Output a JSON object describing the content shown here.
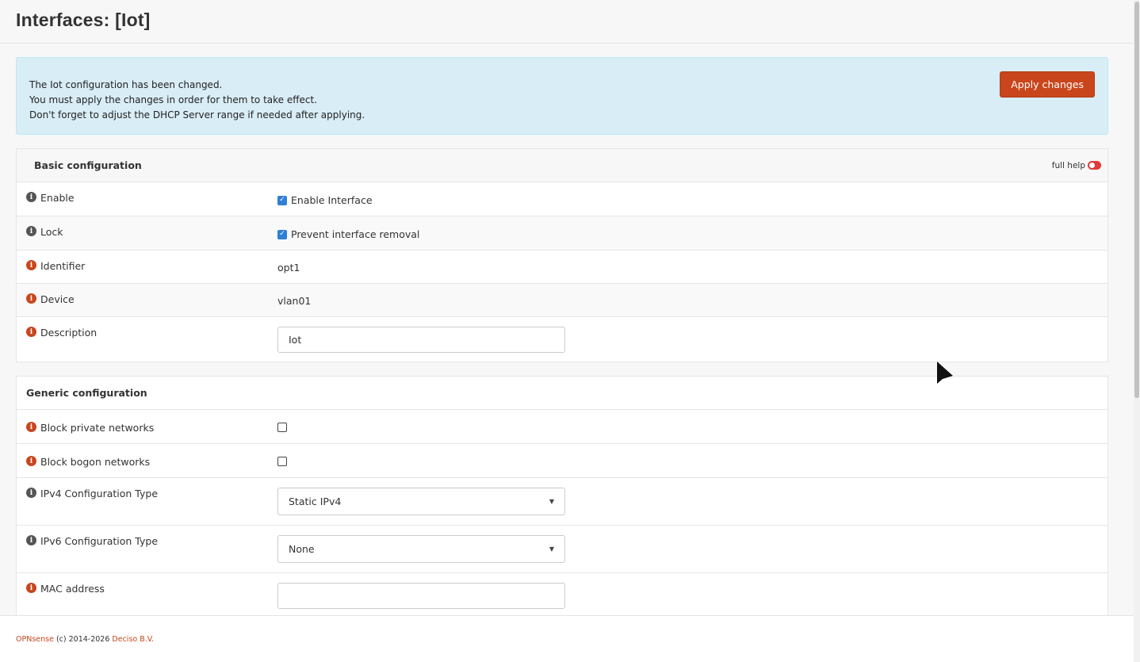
{
  "page": {
    "title": "Interfaces: [Iot]"
  },
  "alert": {
    "line1": "The Iot configuration has been changed.",
    "line2": "You must apply the changes in order for them to take effect.",
    "line3": "Don't forget to adjust the DHCP Server range if needed after applying.",
    "apply_label": "Apply changes"
  },
  "basic": {
    "heading": "Basic configuration",
    "full_help": "full help",
    "enable": {
      "label": "Enable",
      "checkbox_label": "Enable Interface",
      "checked": true
    },
    "lock": {
      "label": "Lock",
      "checkbox_label": "Prevent interface removal",
      "checked": true
    },
    "identifier": {
      "label": "Identifier",
      "value": "opt1"
    },
    "device": {
      "label": "Device",
      "value": "vlan01"
    },
    "description": {
      "label": "Description",
      "value": "Iot"
    }
  },
  "generic": {
    "heading": "Generic configuration",
    "block_private": {
      "label": "Block private networks",
      "checked": false
    },
    "block_bogon": {
      "label": "Block bogon networks",
      "checked": false
    },
    "ipv4": {
      "label": "IPv4 Configuration Type",
      "value": "Static IPv4"
    },
    "ipv6": {
      "label": "IPv6 Configuration Type",
      "value": "None"
    },
    "mac": {
      "label": "MAC address",
      "value": ""
    }
  },
  "footer": {
    "brand": "OPNsense",
    "copyright": " (c) 2014-2026 ",
    "company": "Deciso B.V."
  },
  "colors": {
    "accent": "#c9461c",
    "checkbox": "#2f7fd6",
    "alert_bg": "#d9edf7"
  }
}
